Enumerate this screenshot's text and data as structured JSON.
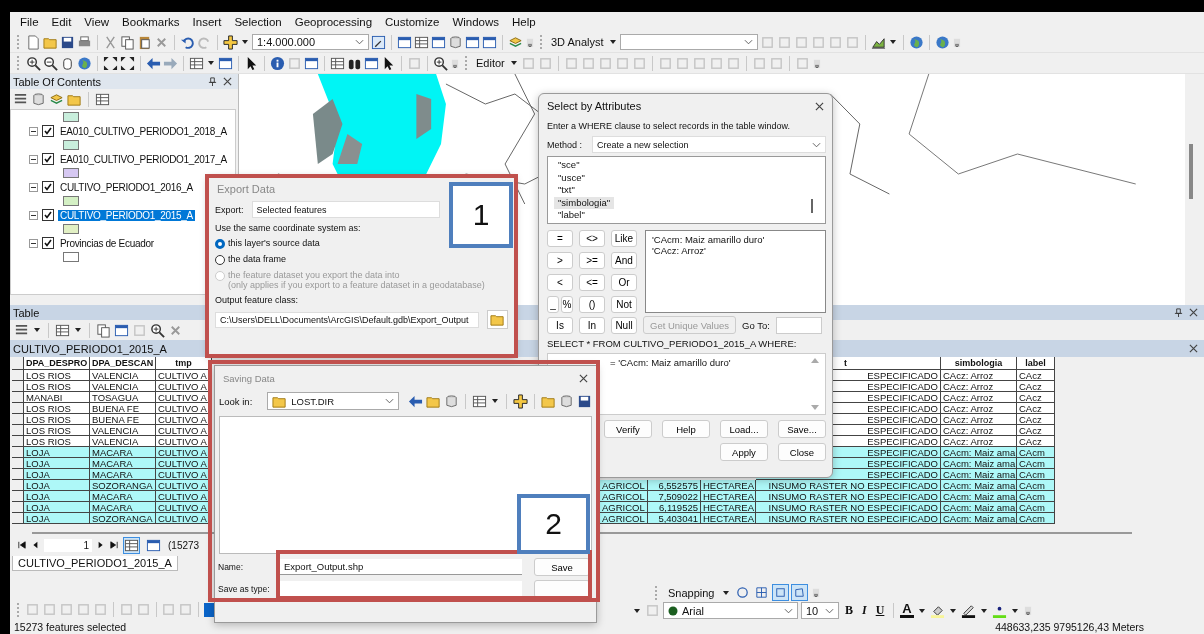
{
  "menu_bar": {
    "items": [
      "File",
      "Edit",
      "View",
      "Bookmarks",
      "Insert",
      "Selection",
      "Geoprocessing",
      "Customize",
      "Windows",
      "Help"
    ]
  },
  "standard_toolbar": {
    "map_scale": "1:4.000.000",
    "analyst_menu": "3D Analyst"
  },
  "tools_toolbar": {
    "editor_menu": "Editor"
  },
  "table_of_contents": {
    "title": "Table Of Contents",
    "scrolled_item": {
      "color": "#c8eedc"
    },
    "layers": [
      {
        "name": "EA010_CULTIVO_PERIODO1_2018_A",
        "checked": true,
        "expanded": true,
        "selected": false,
        "color": "#c8eedc"
      },
      {
        "name": "EA010_CULTIVO_PERIODO1_2017_A",
        "checked": true,
        "expanded": true,
        "selected": false,
        "color": "#d6c8f2"
      },
      {
        "name": "CULTIVO_PERIODO1_2016_A",
        "checked": true,
        "expanded": true,
        "selected": false,
        "color": "#d4f0c4"
      },
      {
        "name": "CULTIVO_PERIODO1_2015_A",
        "checked": true,
        "expanded": true,
        "selected": true,
        "color": "#e2f0c4"
      },
      {
        "name": "Provincias de Ecuador",
        "checked": true,
        "expanded": true,
        "selected": false,
        "color": "#ffffff"
      }
    ]
  },
  "table": {
    "title": "Table",
    "layer_title": "CULTIVO_PERIODO1_2015_A",
    "left_columns": [
      "DPA_DESPRO",
      "DPA_DESCAN",
      "tmp"
    ],
    "right_columns": {
      "column_7": "t",
      "simbologia": "simbologia",
      "label": "label"
    },
    "rows": [
      {
        "selected": false,
        "cells": [
          "LOS RIOS",
          "VALENCIA",
          "CULTIVO A"
        ],
        "right": {
          "column_7": "ESPECIFICADO",
          "simbologia": "CAcz: Arroz",
          "label": "CAcz"
        }
      },
      {
        "selected": false,
        "cells": [
          "LOS RIOS",
          "VALENCIA",
          "CULTIVO A"
        ],
        "right": {
          "column_7": "ESPECIFICADO",
          "simbologia": "CAcz: Arroz",
          "label": "CAcz"
        }
      },
      {
        "selected": false,
        "cells": [
          "MANABI",
          "TOSAGUA",
          "CULTIVO A"
        ],
        "right": {
          "column_7": "ESPECIFICADO",
          "simbologia": "CAcz: Arroz",
          "label": "CAcz"
        }
      },
      {
        "selected": false,
        "cells": [
          "LOS RIOS",
          "BUENA FE",
          "CULTIVO A"
        ],
        "right": {
          "column_7": "ESPECIFICADO",
          "simbologia": "CAcz: Arroz",
          "label": "CAcz"
        }
      },
      {
        "selected": false,
        "cells": [
          "LOS RIOS",
          "BUENA FE",
          "CULTIVO A"
        ],
        "right": {
          "column_7": "ESPECIFICADO",
          "simbologia": "CAcz: Arroz",
          "label": "CAcz"
        }
      },
      {
        "selected": false,
        "cells": [
          "LOS RIOS",
          "VALENCIA",
          "CULTIVO A"
        ],
        "right": {
          "column_7": "ESPECIFICADO",
          "simbologia": "CAcz: Arroz",
          "label": "CAcz"
        }
      },
      {
        "selected": false,
        "cells": [
          "LOS RIOS",
          "VALENCIA",
          "CULTIVO A"
        ],
        "right": {
          "column_7": "ESPECIFICADO",
          "simbologia": "CAcz: Arroz",
          "label": "CAcz"
        }
      },
      {
        "selected": true,
        "cells": [
          "LOJA",
          "MACARA",
          "CULTIVO A"
        ],
        "right": {
          "column_7": "ESPECIFICADO",
          "simbologia": "CAcm: Maiz ama",
          "label": "CAcm"
        }
      },
      {
        "selected": true,
        "cells": [
          "LOJA",
          "MACARA",
          "CULTIVO A"
        ],
        "right": {
          "column_7": "ESPECIFICADO",
          "simbologia": "CAcm: Maiz ama",
          "label": "CAcm"
        }
      },
      {
        "selected": true,
        "cells": [
          "LOJA",
          "MACARA",
          "CULTIVO A"
        ],
        "right": {
          "column_7": "ESPECIFICADO",
          "simbologia": "CAcm: Maiz ama",
          "label": "CAcm"
        }
      },
      {
        "selected": true,
        "cells": [
          "LOJA",
          "SOZORANGA",
          "CULTIVO A"
        ],
        "right": {
          "column_4": "AGRICOL",
          "column_5": "6,552575",
          "column_6": "HECTAREA",
          "column_7": "INSUMO RASTER NO ESPECIFICADO",
          "simbologia": "CAcm: Maiz ama",
          "label": "CAcm"
        }
      },
      {
        "selected": true,
        "cells": [
          "LOJA",
          "MACARA",
          "CULTIVO A"
        ],
        "right": {
          "column_4": "AGRICOL",
          "column_5": "7,509022",
          "column_6": "HECTAREA",
          "column_7": "INSUMO RASTER NO ESPECIFICADO",
          "simbologia": "CAcm: Maiz ama",
          "label": "CAcm"
        }
      },
      {
        "selected": true,
        "cells": [
          "LOJA",
          "MACARA",
          "CULTIVO A"
        ],
        "right": {
          "column_4": "AGRICOL",
          "column_5": "6,119525",
          "column_6": "HECTAREA",
          "column_7": "INSUMO RASTER NO ESPECIFICADO",
          "simbologia": "CAcm: Maiz ama",
          "label": "CAcm"
        }
      },
      {
        "selected": true,
        "cells": [
          "LOJA",
          "SOZORANGA",
          "CULTIVO A"
        ],
        "right": {
          "column_4": "AGRICOL",
          "column_5": "5,403041",
          "column_6": "HECTAREA",
          "column_7": "INSUMO RASTER NO ESPECIFICADO",
          "simbologia": "CAcm: Maiz ama",
          "label": "CAcm"
        }
      }
    ],
    "record_number": "1",
    "selection_count": "(15273",
    "view_tab": "CULTIVO_PERIODO1_2015_A"
  },
  "snapping_toolbar": {
    "menu": "Snapping"
  },
  "draw_toolbar": {
    "font": "Arial",
    "size": "10",
    "style_buttons": [
      "B",
      "I",
      "U"
    ],
    "font_color_glyph": "A"
  },
  "status_bar": {
    "message": "15273 features selected",
    "coordinates": "448633,235  9795126,43 Meters"
  },
  "select_by_attributes": {
    "title": "Select by Attributes",
    "instruction": "Enter a WHERE clause to select records in the table window.",
    "method_label": "Method :",
    "method": "Create a new selection",
    "fields": [
      {
        "name": "\"sce\"",
        "selected": false
      },
      {
        "name": "\"usce\"",
        "selected": false
      },
      {
        "name": "\"txt\"",
        "selected": false
      },
      {
        "name": "\"simbologia\"",
        "selected": true
      },
      {
        "name": "\"label\"",
        "selected": false
      }
    ],
    "operators": [
      [
        "=",
        "<>",
        "Like"
      ],
      [
        ">",
        ">=",
        "And"
      ],
      [
        "<",
        "<=",
        "Or"
      ],
      [
        "_",
        "%",
        "()",
        "Not"
      ],
      [
        "Is",
        "In",
        "Null"
      ]
    ],
    "values": [
      "'CAcm: Maiz amarillo duro'",
      "'CAcz: Arroz'"
    ],
    "unique_values_button": {
      "label": "Get Unique Values",
      "disabled": true
    },
    "go_to_label": "Go To:",
    "query_header": "SELECT * FROM CULTIVO_PERIODO1_2015_A WHERE:",
    "expression": "= 'CAcm: Maiz amarillo duro'",
    "buttons": [
      "Verify",
      "Help",
      "Load...",
      "Save..."
    ],
    "footer_buttons": [
      "Apply",
      "Close"
    ]
  },
  "export_data": {
    "title": "Export Data",
    "export_label": "Export:",
    "export_value": "Selected features",
    "coordinate_label": "Use the same coordinate system as:",
    "options": [
      {
        "label": "this layer's source data",
        "selected": true,
        "disabled": false
      },
      {
        "label": "the data frame",
        "selected": false,
        "disabled": false
      },
      {
        "label": "the feature dataset you export the data into",
        "note": "(only applies if you export to a feature dataset in a geodatabase)",
        "selected": false,
        "disabled": true
      }
    ],
    "output_label": "Output feature class:",
    "output_path": "C:\\Users\\DELL\\Documents\\ArcGIS\\Default.gdb\\Export_Output"
  },
  "saving_data": {
    "title": "Saving Data",
    "look_in_label": "Look in:",
    "look_in": "LOST.DIR",
    "name_label": "Name:",
    "name": "Export_Output.shp",
    "save_button": "Save",
    "type_label": "Save as type:"
  },
  "callouts": [
    {
      "label": "1"
    },
    {
      "label": "2"
    }
  ]
}
